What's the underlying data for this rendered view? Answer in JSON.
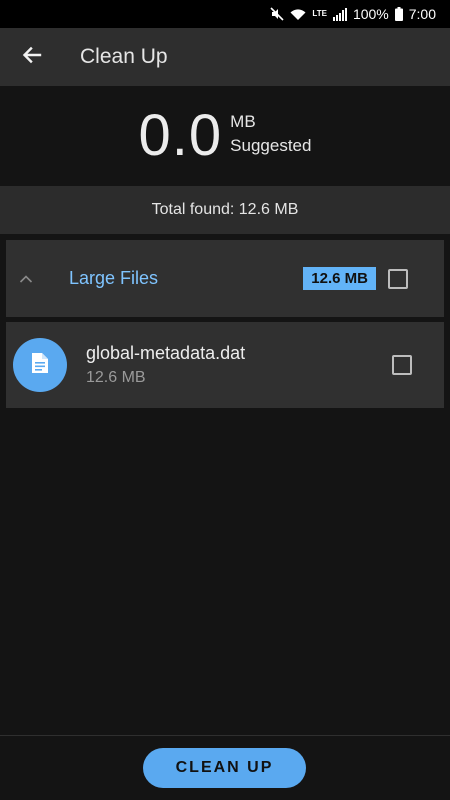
{
  "status_bar": {
    "battery": "100%",
    "time": "7:00",
    "network": "LTE",
    "icons": [
      "mute-icon",
      "wifi-icon",
      "signal-icon",
      "battery-icon"
    ]
  },
  "app_bar": {
    "back_icon": "arrow-left-icon",
    "title": "Clean Up"
  },
  "summary": {
    "value": "0.0",
    "unit": "MB",
    "caption": "Suggested",
    "total_found": "Total found: 12.6 MB"
  },
  "group": {
    "chevron_icon": "chevron-up-icon",
    "title": "Large Files",
    "size_badge": "12.6 MB",
    "checked": false
  },
  "files": [
    {
      "icon": "document-icon",
      "name": "global-metadata.dat",
      "size": "12.6 MB",
      "checked": false
    }
  ],
  "action": {
    "label": "CLEAN UP"
  },
  "colors": {
    "accent": "#5aa9f0",
    "group_title": "#7fc4ff",
    "background": "#141414",
    "surface": "#303030"
  }
}
